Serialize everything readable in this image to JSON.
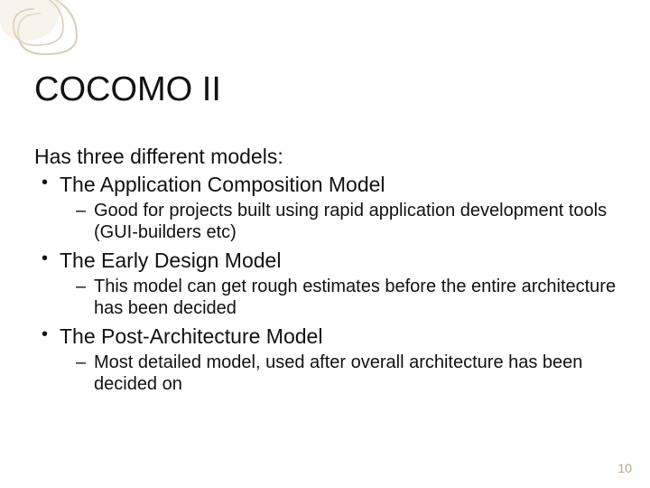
{
  "slide": {
    "title": "COCOMO II",
    "intro": "Has three different models:",
    "items": [
      {
        "label": "The Application Composition Model",
        "desc": "Good for projects built using rapid application development tools (GUI-builders etc)"
      },
      {
        "label": "The Early Design Model",
        "desc": "This model can get rough estimates before the entire architecture has been decided"
      },
      {
        "label": "The Post-Architecture Model",
        "desc": "Most detailed model, used after overall architecture has been decided on"
      }
    ],
    "page_number": "10"
  }
}
